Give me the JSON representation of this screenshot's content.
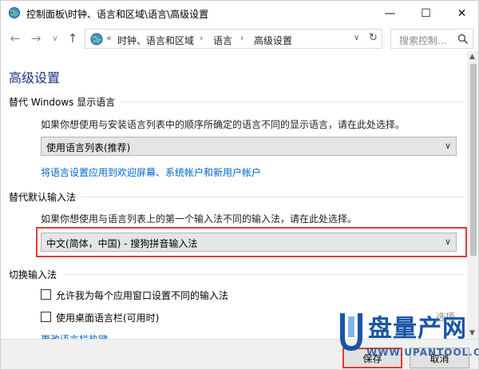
{
  "window": {
    "title": "控制面板\\时钟、语言和区域\\语言\\高级设置",
    "icons": {
      "app": "control-panel-globe-icon",
      "minimize": "minimize-icon",
      "maximize": "maximize-icon",
      "close": "close-icon"
    },
    "controls": {
      "minimize": "—",
      "maximize": "☐",
      "close": "✕"
    }
  },
  "nav": {
    "back": "←",
    "forward": "→",
    "dropdown": "∨",
    "up": "↑",
    "address": {
      "prefix": "«",
      "crumbs": [
        "时钟、语言和区域",
        "语言",
        "高级设置"
      ],
      "separator": "›",
      "drop": "∨",
      "refresh": "↻"
    },
    "search": {
      "placeholder": "搜索控制..."
    }
  },
  "content": {
    "page_title": "高级设置",
    "display_language": {
      "title": "替代 Windows 显示语言",
      "description": "如果你想使用与安装语言列表中的顺序所确定的语言不同的显示语言，请在此处选择。",
      "select_value": "使用语言列表(推荐)",
      "link": "将语言设置应用到欢迎屏幕、系统帐户和新用户帐户"
    },
    "default_input": {
      "title": "替代默认输入法",
      "description": "如果你想使用与语言列表上的第一个输入法不同的输入法，请在此处选择。",
      "select_value": "中文(简体，中国) - 搜狗拼音输入法"
    },
    "switch_input": {
      "title": "切换输入法",
      "checkbox1": "允许我为每个应用窗口设置不同的输入法",
      "checkbox2": "使用桌面语言栏(可用时)",
      "options": "选项",
      "link": "更改语言栏热键"
    }
  },
  "footer": {
    "save": "保存",
    "cancel": "取消"
  },
  "watermark": {
    "text": "盘量产网",
    "url": "WWW.UPANTOOL.COM"
  },
  "colors": {
    "title_blue": "#1e3287",
    "link_blue": "#0066cc",
    "highlight_red": "#e53935",
    "watermark_blue": "#1a55a5"
  },
  "scrollbar": {
    "up": "▲",
    "down": "▼"
  }
}
